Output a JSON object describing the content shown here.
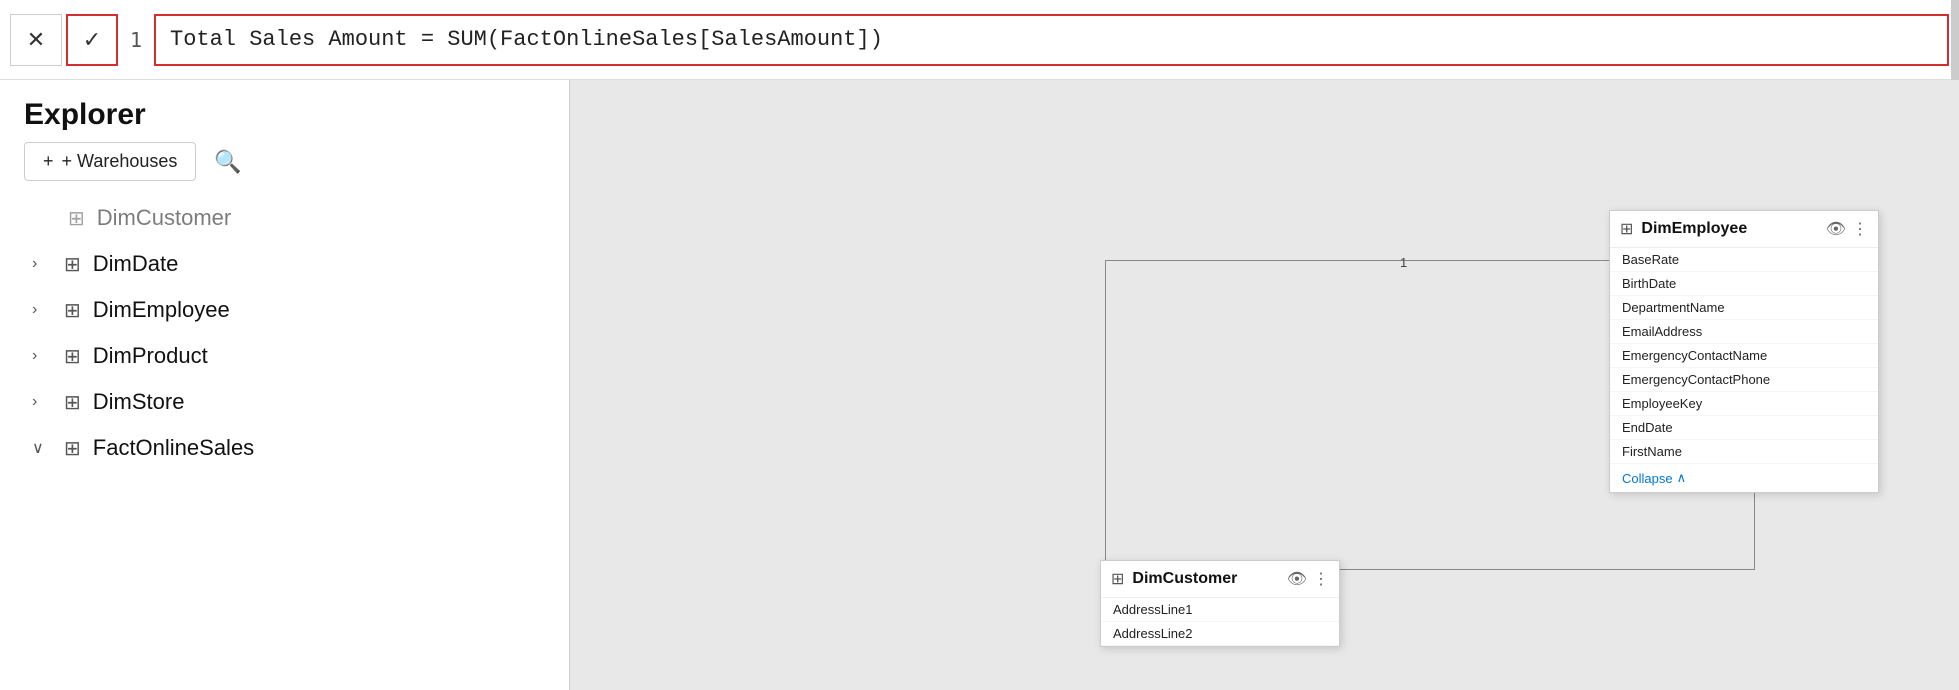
{
  "formulaBar": {
    "lineNum": "1",
    "formulaText": "Total Sales Amount = ",
    "formulaBlue": "SUM(FactOnlineSales[SalesAmount])",
    "formulaFull": "Total Sales Amount = SUM(FactOnlineSales[SalesAmount])"
  },
  "sidebar": {
    "title": "Explorer",
    "addButton": "+ Warehouses",
    "searchIcon": "🔍",
    "items": [
      {
        "label": "DimCustomer",
        "chevron": "",
        "expanded": false,
        "partial": true
      },
      {
        "label": "DimDate",
        "chevron": ">",
        "expanded": false
      },
      {
        "label": "DimEmployee",
        "chevron": ">",
        "expanded": false
      },
      {
        "label": "DimProduct",
        "chevron": ">",
        "expanded": false
      },
      {
        "label": "DimStore",
        "chevron": ">",
        "expanded": false
      },
      {
        "label": "FactOnlineSales",
        "chevron": "∨",
        "expanded": true
      }
    ]
  },
  "dimEmployeeCard": {
    "title": "DimEmployee",
    "fields": [
      "BaseRate",
      "BirthDate",
      "DepartmentName",
      "EmailAddress",
      "EmergencyContactName",
      "EmergencyContactPhone",
      "EmployeeKey",
      "EndDate",
      "FirstName"
    ],
    "collapseLabel": "Collapse"
  },
  "dimCustomerCard": {
    "title": "DimCustomer",
    "fields": [
      "AddressLine1",
      "AddressLine2"
    ]
  }
}
